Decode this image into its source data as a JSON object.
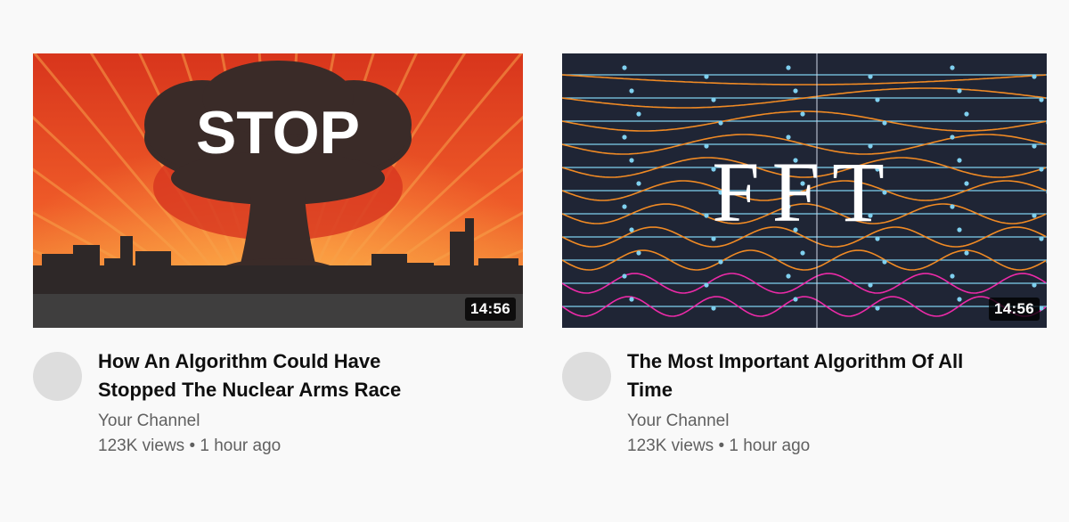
{
  "videos": [
    {
      "thumbnail_text": "STOP",
      "duration": "14:56",
      "title": "How An Algorithm Could Have Stopped The Nuclear Arms Race",
      "channel": "Your Channel",
      "views": "123K views",
      "separator": "•",
      "age": "1 hour ago"
    },
    {
      "thumbnail_text": "FFT",
      "duration": "14:56",
      "title": "The Most Important Algorithm Of All Time",
      "channel": "Your Channel",
      "views": "123K views",
      "separator": "•",
      "age": "1 hour ago"
    }
  ],
  "colors": {
    "background": "#f9f9f9",
    "title_text": "#0f0f0f",
    "secondary_text": "#606060",
    "thumb1_sky": "#e0401f",
    "thumb2_bg": "#1f2535",
    "wave_orange": "#f08a24",
    "wave_magenta": "#ec2aa8",
    "grid_blue": "#7fd0ef"
  }
}
